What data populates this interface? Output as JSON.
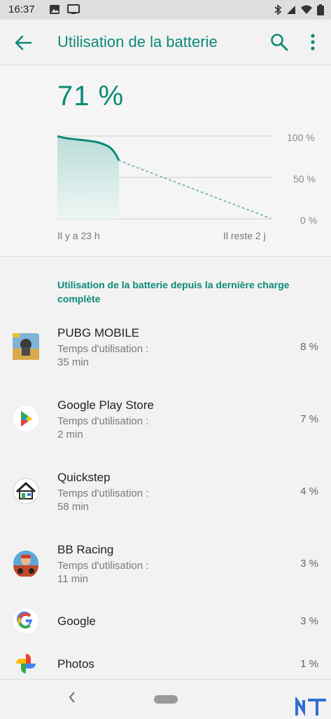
{
  "status_bar": {
    "time": "16:37"
  },
  "app_bar": {
    "title": "Utilisation de la batterie"
  },
  "battery": {
    "level_text": "71 %",
    "level": 71,
    "chart": {
      "y_labels": [
        "100 %",
        "50 %",
        "0 %"
      ],
      "x_start_label": "Il y a 23 h",
      "x_end_label": "Il reste 2 j"
    }
  },
  "section": {
    "title": "Utilisation de la batterie depuis la dernière charge complète"
  },
  "apps": [
    {
      "name": "PUBG MOBILE",
      "usage_label": "Temps d'utilisation :",
      "usage_value": "35 min",
      "percent": "8 %",
      "icon": "pubg-icon"
    },
    {
      "name": "Google Play Store",
      "usage_label": "Temps d'utilisation :",
      "usage_value": "2 min",
      "percent": "7 %",
      "icon": "play-store-icon"
    },
    {
      "name": "Quickstep",
      "usage_label": "Temps d'utilisation :",
      "usage_value": "58 min",
      "percent": "4 %",
      "icon": "house-icon"
    },
    {
      "name": "BB Racing",
      "usage_label": "Temps d'utilisation :",
      "usage_value": "11 min",
      "percent": "3 %",
      "icon": "bb-racing-icon"
    },
    {
      "name": "Google",
      "percent": "3 %",
      "icon": "google-g-icon"
    },
    {
      "name": "Photos",
      "percent": "1 %",
      "icon": "photos-pinwheel-icon"
    }
  ],
  "colors": {
    "accent": "#0c8a77",
    "chart_fill": "#cfe8e4"
  }
}
